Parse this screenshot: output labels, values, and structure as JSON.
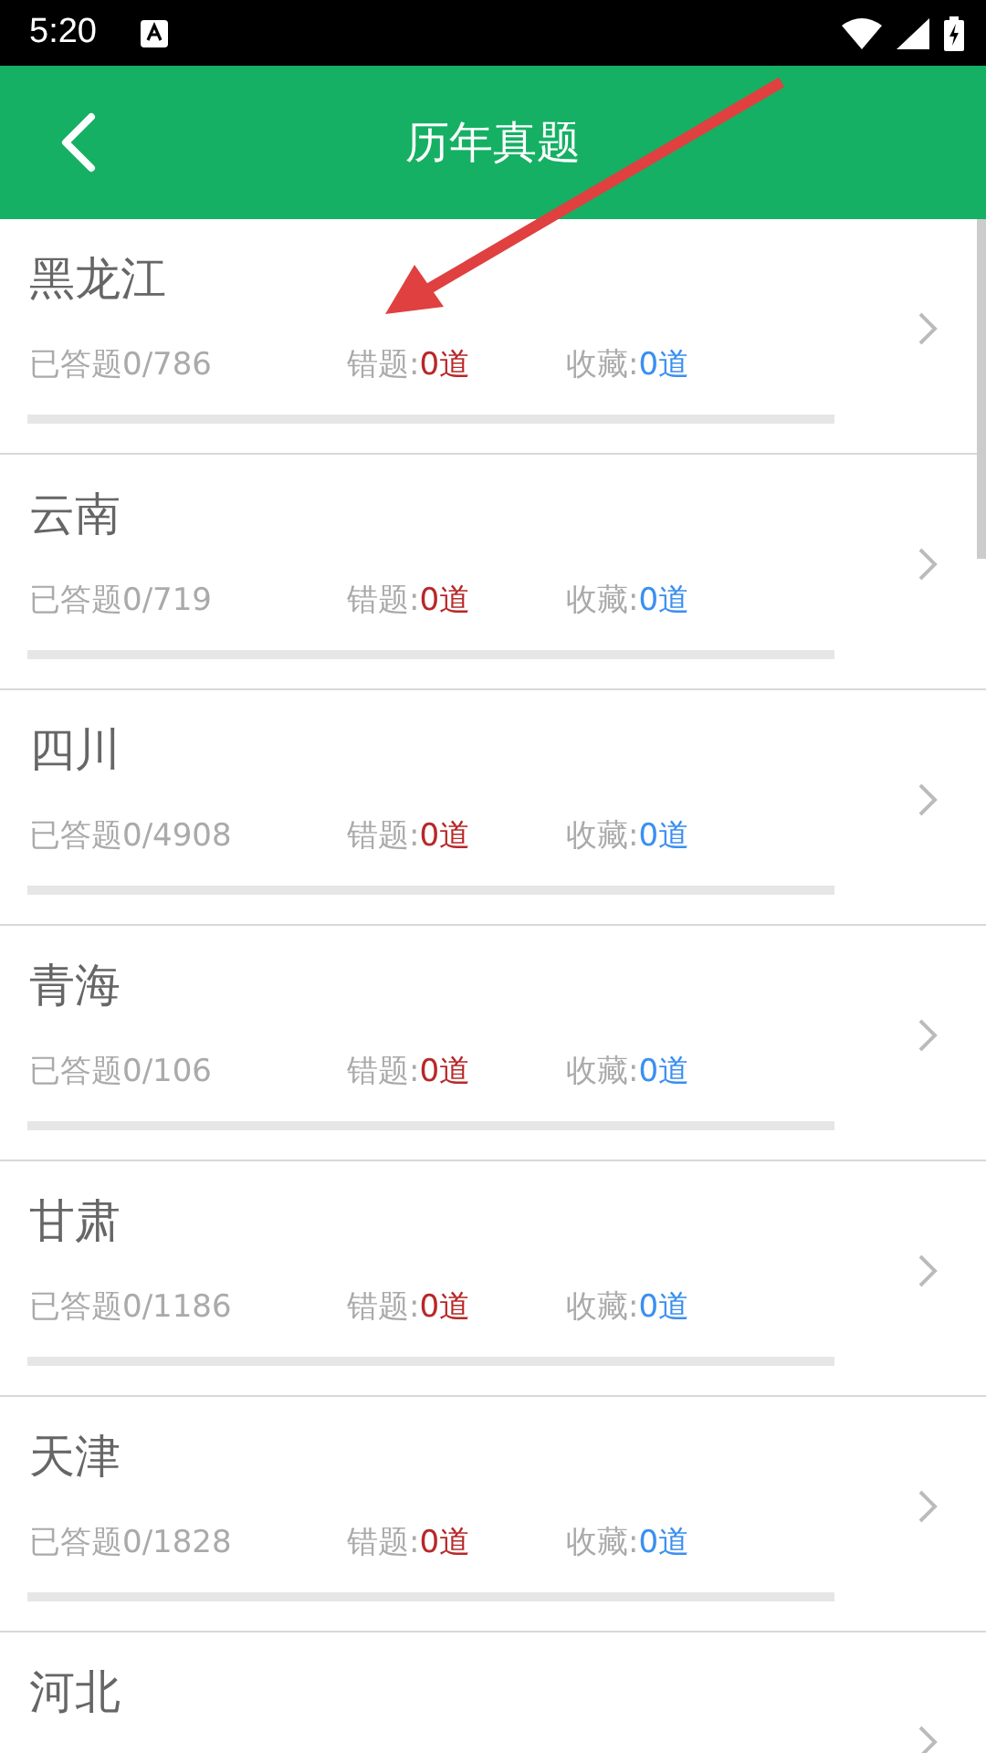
{
  "status_bar": {
    "time": "5:20"
  },
  "header": {
    "title": "历年真题"
  },
  "items": [
    {
      "name": "黑龙江",
      "answered": "已答题0/786",
      "wrong_label": "错题:",
      "wrong_count": "0道",
      "fav_label": "收藏:",
      "fav_count": "0道",
      "level": 0
    },
    {
      "name": "云南",
      "answered": "已答题0/719",
      "wrong_label": "错题:",
      "wrong_count": "0道",
      "fav_label": "收藏:",
      "fav_count": "0道",
      "level": 0
    },
    {
      "name": "四川",
      "answered": "已答题0/4908",
      "wrong_label": "错题:",
      "wrong_count": "0道",
      "fav_label": "收藏:",
      "fav_count": "0道",
      "level": 0
    },
    {
      "name": "青海",
      "answered": "已答题0/106",
      "wrong_label": "错题:",
      "wrong_count": "0道",
      "fav_label": "收藏:",
      "fav_count": "0道",
      "level": 0
    },
    {
      "name": "甘肃",
      "answered": "已答题0/1186",
      "wrong_label": "错题:",
      "wrong_count": "0道",
      "fav_label": "收藏:",
      "fav_count": "0道",
      "level": 0
    },
    {
      "name": "天津",
      "answered": "已答题0/1828",
      "wrong_label": "错题:",
      "wrong_count": "0道",
      "fav_label": "收藏:",
      "fav_count": "0道",
      "level": 0
    },
    {
      "name": "河北"
    }
  ]
}
